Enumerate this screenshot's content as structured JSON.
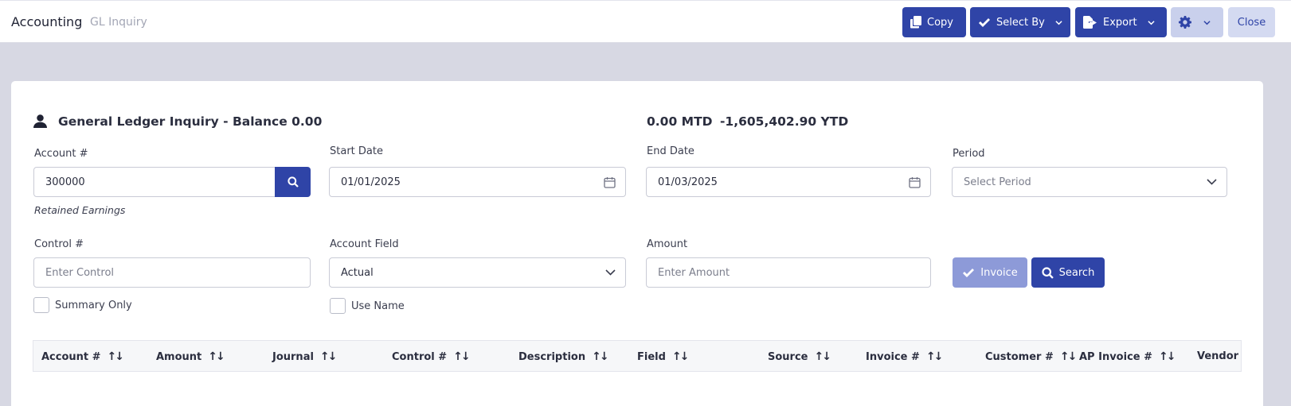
{
  "header": {
    "app_title": "Accounting",
    "breadcrumb": "GL Inquiry",
    "buttons": {
      "copy": "Copy",
      "select_by": "Select By",
      "export": "Export",
      "close": "Close"
    }
  },
  "inquiry": {
    "title": "General Ledger Inquiry - Balance 0.00",
    "mtd": "0.00 MTD",
    "ytd": "-1,605,402.90 YTD"
  },
  "form": {
    "account_label": "Account #",
    "account_value": "300000",
    "account_name": "Retained Earnings",
    "start_date_label": "Start Date",
    "start_date_value": "01/01/2025",
    "end_date_label": "End Date",
    "end_date_value": "01/03/2025",
    "period_label": "Period",
    "period_placeholder": "Select Period",
    "control_label": "Control #",
    "control_placeholder": "Enter Control",
    "account_field_label": "Account Field",
    "account_field_value": "Actual",
    "amount_label": "Amount",
    "amount_placeholder": "Enter Amount",
    "summary_only_label": "Summary Only",
    "use_name_label": "Use Name",
    "invoice_button": "Invoice",
    "search_button": "Search"
  },
  "table": {
    "columns": [
      "Account #",
      "Amount",
      "Journal",
      "Control #",
      "Description",
      "Field",
      "Source",
      "Invoice #",
      "Customer #",
      "AP Invoice #",
      "Vendor #"
    ]
  },
  "colors": {
    "primary": "#2f44a7",
    "disabled_primary": "#8d9ad8",
    "background": "#d7d8e3"
  }
}
